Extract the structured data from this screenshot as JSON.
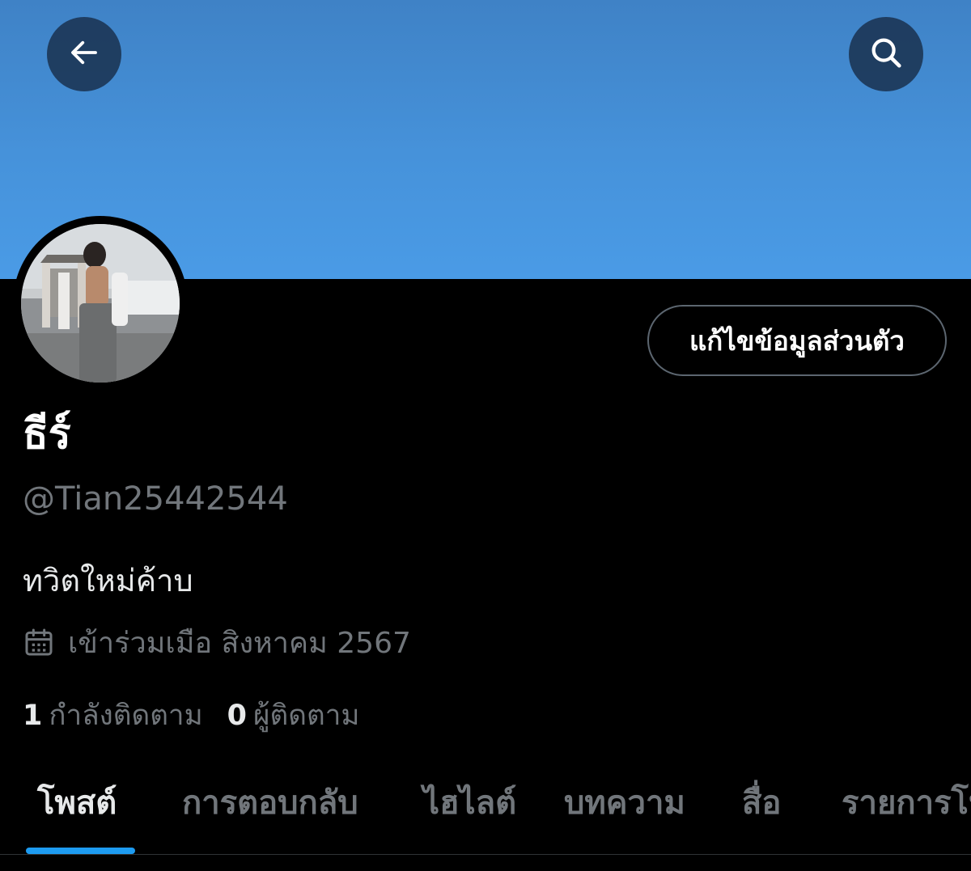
{
  "header": {
    "back_icon": "arrow-left-icon",
    "search_icon": "search-icon",
    "banner_color": "#4692da"
  },
  "profile": {
    "edit_button_label": "แก้ไขข้อมูลส่วนตัว",
    "display_name": "ธีร์",
    "handle": "@Tian25442544",
    "bio": "ทวิตใหม่ค้าบ",
    "joined_icon": "calendar-icon",
    "joined": "เข้าร่วมเมือ สิงหาคม 2567",
    "following_count": "1",
    "following_label": "กำลังติดตาม",
    "followers_count": "0",
    "followers_label": "ผู้ติดตาม"
  },
  "tabs": [
    {
      "label": "โพสต์",
      "active": true
    },
    {
      "label": "การตอบกลับ",
      "active": false
    },
    {
      "label": "ไฮไลต์",
      "active": false
    },
    {
      "label": "บทความ",
      "active": false
    },
    {
      "label": "สื่อ",
      "active": false
    },
    {
      "label": "รายการโปรด",
      "active": false
    }
  ],
  "colors": {
    "accent": "#1d9bf0",
    "muted_text": "#71767b",
    "background": "#000000"
  }
}
